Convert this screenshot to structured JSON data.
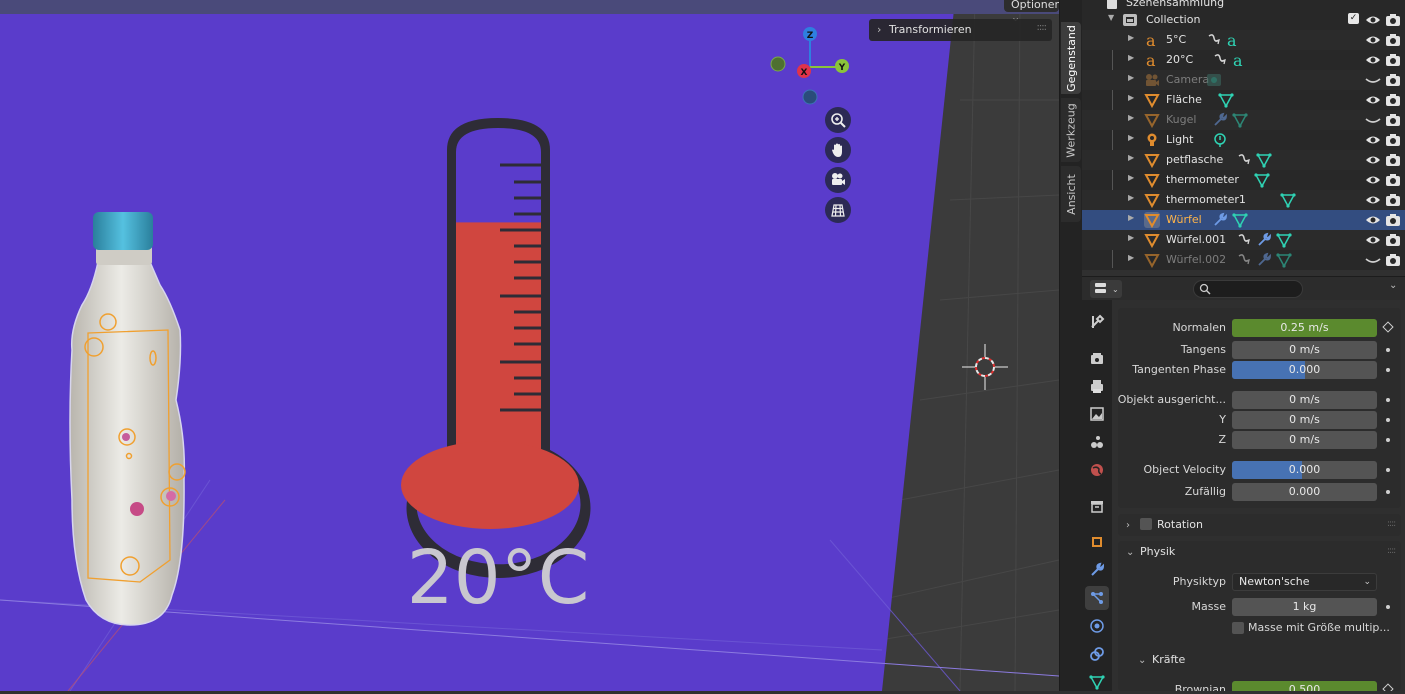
{
  "viewport": {
    "options_label": "Optionen",
    "sidebar_panel": "Transformieren",
    "temperature_text": "20°C",
    "gizmo": {
      "z": "Z",
      "x": "X",
      "y": "Y"
    },
    "thermometer_fill_fraction": 0.72,
    "colors": {
      "background": "#5a3ccb",
      "mercury": "#d0463f",
      "bottle": "#dcd9d2",
      "cap": "#3aa6c6",
      "selection": "#f0a030"
    }
  },
  "side_tabs": [
    "Gegenstand",
    "Werkzeug",
    "Ansicht"
  ],
  "outliner": {
    "header": "Szenensammlung",
    "collection": "Collection",
    "items": [
      {
        "name": "5°C",
        "icon": "text-object-icon",
        "mods": [
          "constraint-icon",
          "text-data-icon"
        ],
        "visible": true,
        "dim": false,
        "selected": false
      },
      {
        "name": "20°C",
        "icon": "text-object-icon",
        "mods": [
          "constraint-icon",
          "text-data-icon"
        ],
        "visible": true,
        "dim": false,
        "selected": false
      },
      {
        "name": "Camera",
        "icon": "camera-object-icon",
        "mods": [
          "camera-data-icon"
        ],
        "visible": false,
        "dim": true,
        "selected": false
      },
      {
        "name": "Fläche",
        "icon": "mesh-object-icon",
        "mods": [
          "mesh-data-icon"
        ],
        "visible": true,
        "dim": false,
        "selected": false
      },
      {
        "name": "Kugel",
        "icon": "mesh-object-icon",
        "mods": [
          "wrench-icon",
          "mesh-data-icon"
        ],
        "visible": false,
        "dim": true,
        "selected": false
      },
      {
        "name": "Light",
        "icon": "light-object-icon",
        "mods": [
          "light-data-icon"
        ],
        "visible": true,
        "dim": false,
        "selected": false
      },
      {
        "name": "petflasche",
        "icon": "mesh-object-icon",
        "mods": [
          "constraint-icon",
          "mesh-data-icon"
        ],
        "visible": true,
        "dim": false,
        "selected": false
      },
      {
        "name": "thermometer",
        "icon": "mesh-object-icon",
        "mods": [
          "mesh-data-icon"
        ],
        "visible": true,
        "dim": false,
        "selected": false
      },
      {
        "name": "thermometer1",
        "icon": "mesh-object-icon",
        "mods": [
          "mesh-data-icon"
        ],
        "visible": true,
        "dim": false,
        "selected": false
      },
      {
        "name": "Würfel",
        "icon": "mesh-object-icon",
        "mods": [
          "wrench-icon",
          "mesh-data-icon"
        ],
        "visible": true,
        "dim": false,
        "selected": true
      },
      {
        "name": "Würfel.001",
        "icon": "mesh-object-icon",
        "mods": [
          "constraint-icon",
          "wrench-icon",
          "mesh-data-icon"
        ],
        "visible": true,
        "dim": false,
        "selected": false
      },
      {
        "name": "Würfel.002",
        "icon": "mesh-object-icon",
        "mods": [
          "constraint-icon",
          "wrench-icon",
          "mesh-data-icon"
        ],
        "visible": false,
        "dim": true,
        "selected": false
      }
    ]
  },
  "properties": {
    "search_placeholder": "",
    "fields": {
      "normalen": {
        "label": "Normalen",
        "value": "0.25 m/s"
      },
      "tangens": {
        "label": "Tangens",
        "value": "0 m/s"
      },
      "tangenten_phase": {
        "label": "Tangenten Phase",
        "value": "0.000"
      },
      "objekt_ausgericht": {
        "label": "Objekt ausgericht...",
        "value": "0 m/s"
      },
      "y": {
        "label": "Y",
        "value": "0 m/s"
      },
      "z": {
        "label": "Z",
        "value": "0 m/s"
      },
      "object_velocity": {
        "label": "Object Velocity",
        "value": "0.000"
      },
      "zufaellig": {
        "label": "Zufällig",
        "value": "0.000"
      },
      "physiktyp": {
        "label": "Physiktyp",
        "value": "Newton'sche"
      },
      "masse": {
        "label": "Masse",
        "value": "1 kg"
      },
      "brownian": {
        "label": "Brownian",
        "value": "0.500"
      }
    },
    "rotation_label": "Rotation",
    "physik_label": "Physik",
    "masse_scale_label": "Masse mit Größe multip...",
    "kraefte_label": "Kräfte"
  }
}
